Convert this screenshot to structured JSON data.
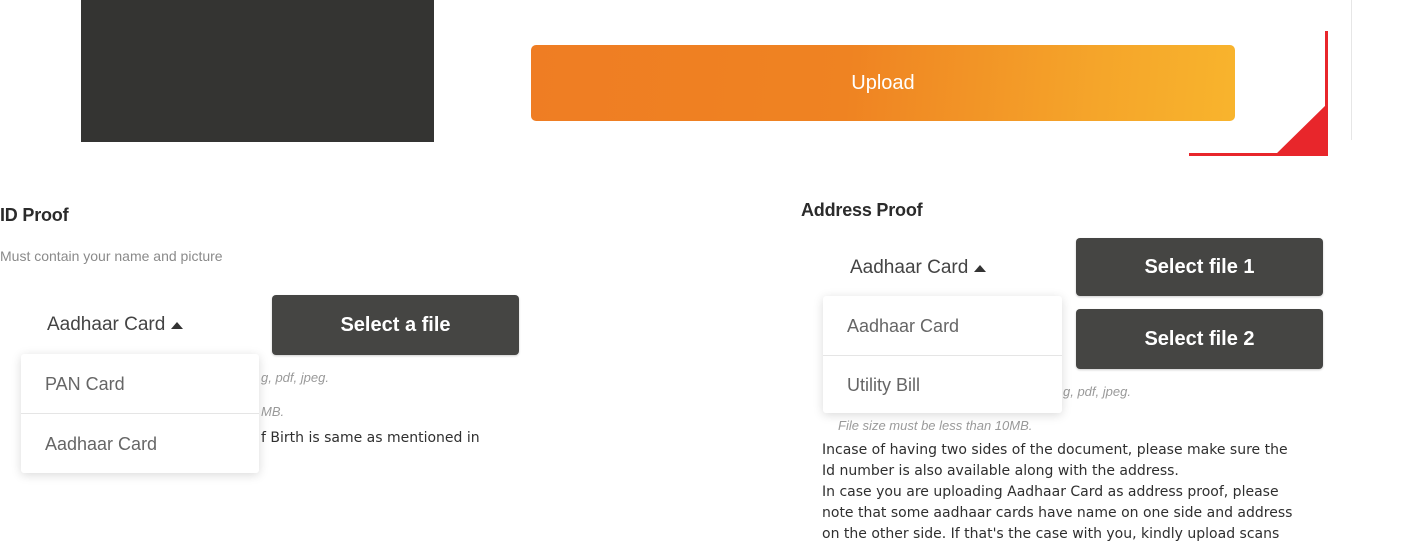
{
  "upload": {
    "label": "Upload"
  },
  "colors": {
    "upload_gradient_start": "#ef7d23",
    "upload_gradient_end": "#f8b42d",
    "select_button_bg": "#454543",
    "accent_red": "#e8262b",
    "dark_panel": "#343432"
  },
  "id_proof": {
    "title": "ID Proof",
    "subtitle": "Must contain your name and picture",
    "selected_doc": "Aadhaar Card",
    "select_button": "Select a file",
    "menu_items": [
      "PAN Card",
      "Aadhaar Card"
    ],
    "hint_formats_partial": "g, pdf, jpeg.",
    "hint_size_partial": "MB.",
    "note_partial": "f Birth is same as mentioned in"
  },
  "address_proof": {
    "title": "Address Proof",
    "selected_doc": "Aadhaar Card",
    "select_button_1": "Select file 1",
    "select_button_2": "Select file 2",
    "menu_items": [
      "Aadhaar Card",
      "Utility Bill"
    ],
    "hint_formats_partial": "g, pdf, jpeg.",
    "hint_size": "File size must be less than 10MB.",
    "note_lines": [
      "Incase of having two sides of the document, please make sure the",
      "Id number is also available along with the address.",
      "In case you are uploading Aadhaar Card as address proof, please",
      "note that some aadhaar cards have name on one side and address",
      "on the other side. If that's the case with you, kindly upload scans"
    ]
  }
}
